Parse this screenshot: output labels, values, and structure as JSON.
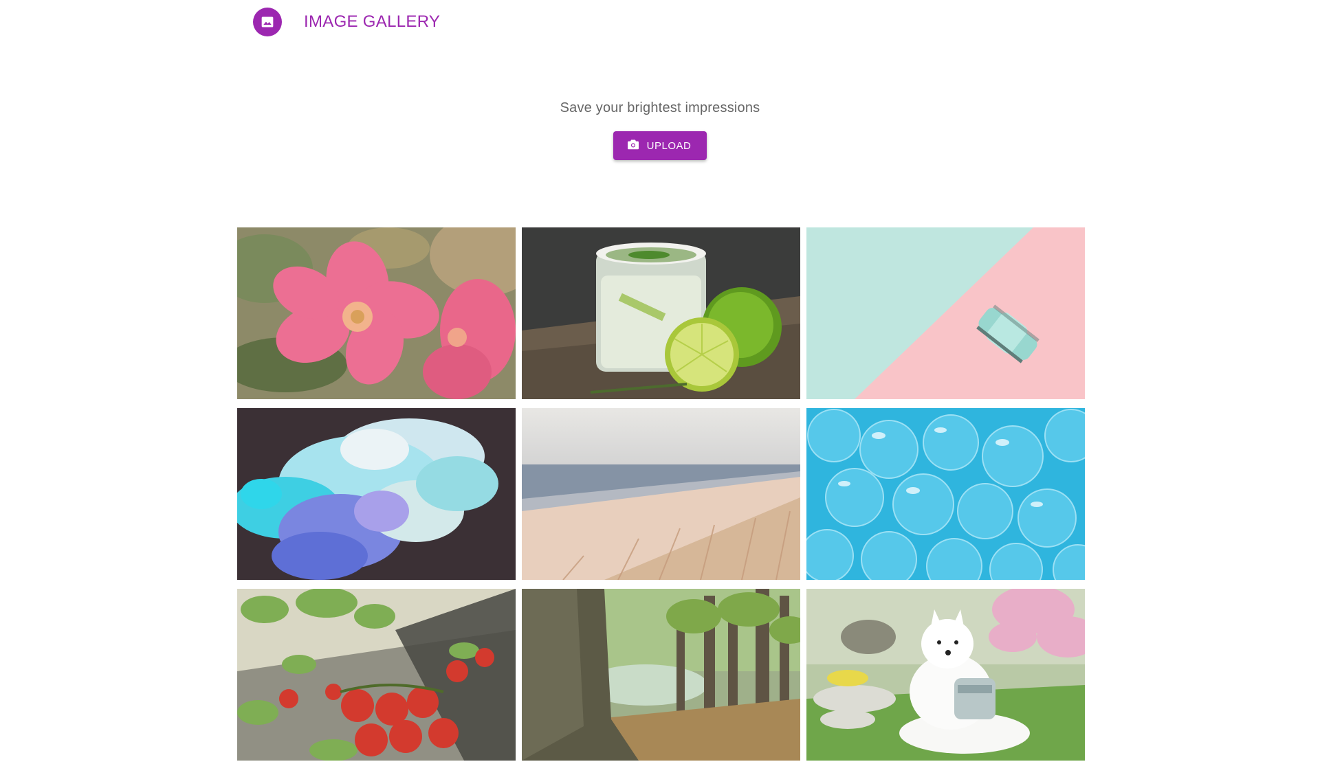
{
  "header": {
    "logo_icon": "image-icon",
    "title": "IMAGE GALLERY",
    "accent_color": "#9c27b0"
  },
  "hero": {
    "tagline": "Save your brightest impressions",
    "upload_button": {
      "icon": "camera-icon",
      "label": "UPLOAD"
    }
  },
  "gallery": {
    "images": [
      {
        "subject": "pink-flower"
      },
      {
        "subject": "lime-cocktail"
      },
      {
        "subject": "toy-car-on-pastel"
      },
      {
        "subject": "ink-cloud"
      },
      {
        "subject": "beach"
      },
      {
        "subject": "blue-bubbles"
      },
      {
        "subject": "tomatoes-and-basil"
      },
      {
        "subject": "forest-tree"
      },
      {
        "subject": "white-dog"
      }
    ]
  }
}
